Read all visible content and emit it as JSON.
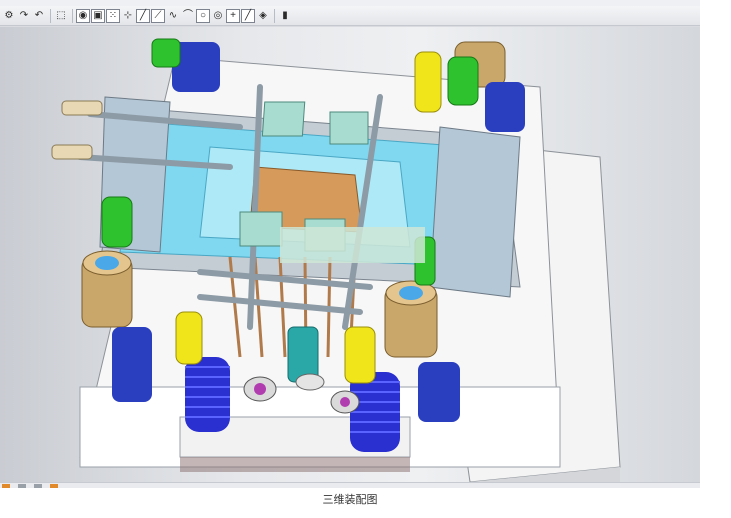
{
  "toolbar": {
    "icons": [
      "settings-dropdown-icon",
      "rotate-icon",
      "undo-icon",
      "select-box-icon",
      "view-shaded-icon",
      "view-cube-icon",
      "point-icon",
      "snap-icon",
      "line-icon",
      "line-diagonal-icon",
      "curve-icon",
      "arc-icon",
      "circle-icon",
      "circle-filled-icon",
      "cross-icon",
      "line-edit-icon",
      "measure-icon",
      "layer-icon"
    ]
  },
  "caption": "三维装配图",
  "colors": {
    "plate_cyan": "#7fd8f0",
    "plate_gray": "#b8c0c8",
    "insert_green": "#2fc22f",
    "pin_yellow": "#f0e41a",
    "spring_blue": "#2a2fcf",
    "bronze": "#c9a66a"
  }
}
